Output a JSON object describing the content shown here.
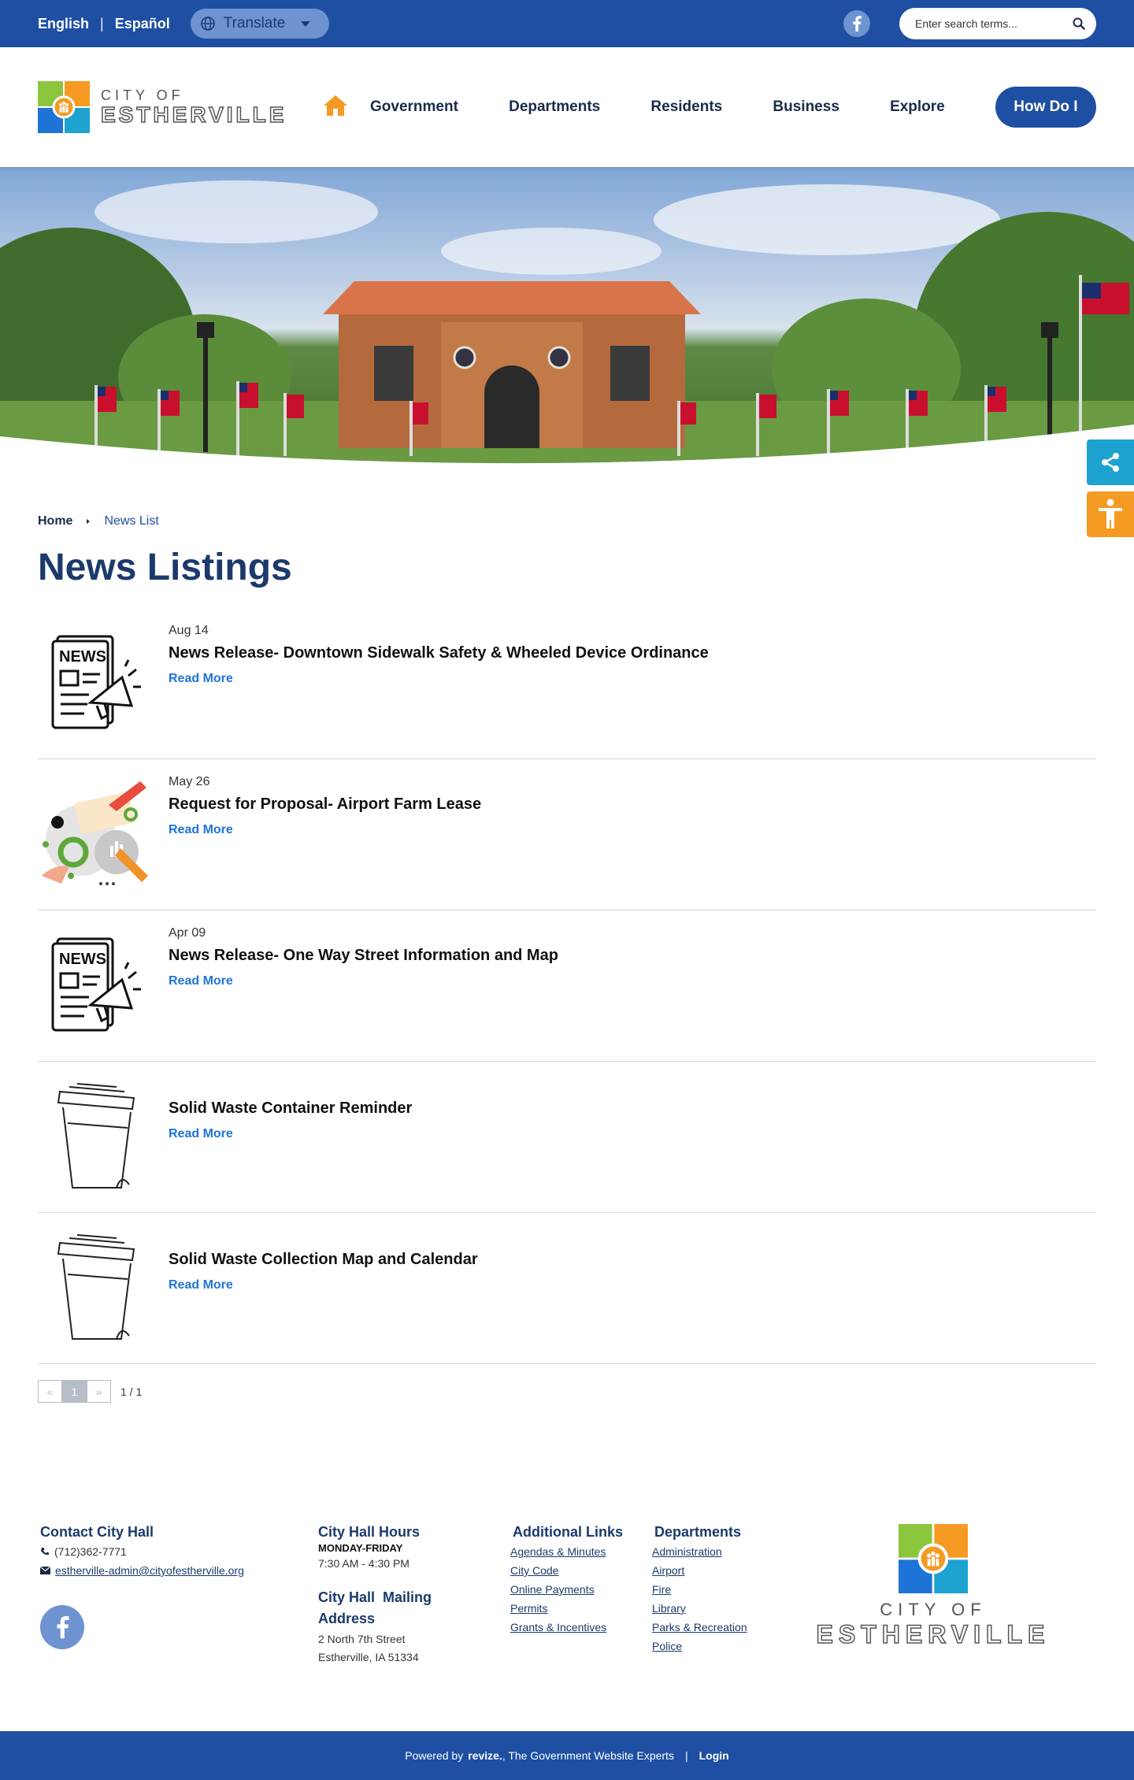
{
  "topbar": {
    "lang_english": "English",
    "lang_spanish": "Español",
    "translate_label": "Translate",
    "search_placeholder": "Enter search terms..."
  },
  "header": {
    "logo_small": "CITY OF",
    "logo_big": "ESTHERVILLE",
    "nav": [
      "Government",
      "Departments",
      "Residents",
      "Business",
      "Explore"
    ],
    "cta": "How Do I"
  },
  "breadcrumb": {
    "home": "Home",
    "current": "News List"
  },
  "page_title": "News Listings",
  "news": [
    {
      "date": "Aug 14",
      "title": "News Release- Downtown Sidewalk Safety & Wheeled Device Ordinance",
      "link": "Read More",
      "icon": "newspaper-icon"
    },
    {
      "date": "May 26",
      "title": "Request for Proposal- Airport Farm Lease",
      "link": "Read More",
      "icon": "proposal-illustration"
    },
    {
      "date": "Apr 09",
      "title": "News Release- One Way Street Information and Map",
      "link": "Read More",
      "icon": "newspaper-icon"
    },
    {
      "date": "",
      "title": "Solid Waste Container Reminder",
      "link": "Read More",
      "icon": "trash-bin-icon"
    },
    {
      "date": "",
      "title": "Solid Waste Collection Map and Calendar",
      "link": "Read More",
      "icon": "trash-bin-icon"
    }
  ],
  "pager": {
    "prev": "«",
    "page": "1",
    "next": "»",
    "count": "1 / 1"
  },
  "footer": {
    "contact_heading": "Contact City Hall",
    "phone": "(712)362-7771",
    "email": "estherville-admin@cityofestherville.org",
    "hours_heading": "City Hall Hours",
    "hours_days": "MONDAY-FRIDAY",
    "hours_time": "7:30 AM - 4:30 PM",
    "mail_heading_1": "City Hall  Mailing",
    "mail_heading_2": "Address",
    "address_1": "2 North 7th Street",
    "address_2": "Estherville, IA 51334",
    "links_heading": "Additional Links",
    "links": [
      "Agendas & Minutes",
      "City Code",
      "Online Payments",
      "Permits",
      "Grants & Incentives"
    ],
    "depts_heading": "Departments",
    "depts": [
      "Administration",
      "Airport",
      "Fire",
      "Library",
      "Parks & Recreation",
      "Police"
    ],
    "logo_small": "CITY OF",
    "logo_big": "ESTHERVILLE"
  },
  "bottom": {
    "powered": "Powered by",
    "brand": "revize.",
    "tagline": ", The Government Website Experts",
    "sep": "|",
    "login": "Login"
  },
  "colors": {
    "primary": "#1e4fa3",
    "accent_orange": "#f59a23",
    "share_blue": "#1ea2d0",
    "link_blue": "#1e74d6"
  }
}
